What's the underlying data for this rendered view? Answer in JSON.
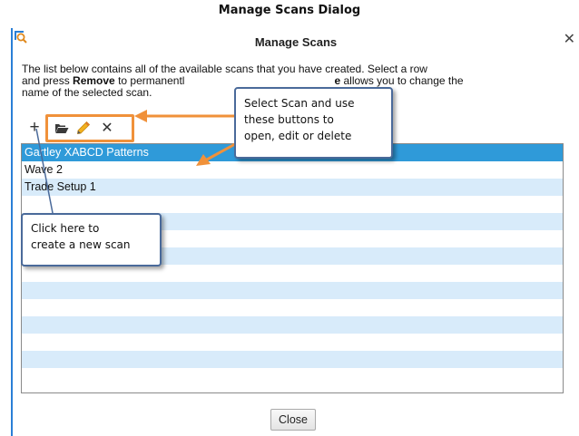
{
  "caption": "Manage Scans Dialog",
  "dialog": {
    "title": "Manage Scans",
    "app_icon": "scan-magnifier-icon",
    "close_glyph": "✕",
    "description": {
      "line1": "The list below contains all of the available scans that you have created.  Select a row",
      "line2_before": "and press ",
      "line2_bold": "Remove",
      "line2_mid": " to permanentl",
      "line2_bold2": "e",
      "line2_after": " allows you to change the",
      "line3": "name of the selected scan."
    },
    "toolbar": {
      "add_icon": "plus-icon",
      "add_glyph": "+",
      "open_icon": "folder-open-icon",
      "edit_icon": "pencil-icon",
      "delete_icon": "close-icon",
      "delete_glyph": "✕"
    },
    "scans": [
      {
        "name": "Gartley XABCD Patterns",
        "selected": true
      },
      {
        "name": "Wave 2",
        "selected": false
      },
      {
        "name": "Trade Setup 1",
        "selected": false
      },
      {
        "name": "",
        "selected": false
      },
      {
        "name": "",
        "selected": false
      },
      {
        "name": "",
        "selected": false
      },
      {
        "name": "",
        "selected": false
      },
      {
        "name": "",
        "selected": false
      },
      {
        "name": "",
        "selected": false
      },
      {
        "name": "",
        "selected": false
      },
      {
        "name": "",
        "selected": false
      },
      {
        "name": "",
        "selected": false
      },
      {
        "name": "",
        "selected": false
      },
      {
        "name": "",
        "selected": false
      }
    ],
    "close_button": "Close"
  },
  "callouts": {
    "edit": [
      "Select Scan and use",
      "these buttons to",
      "open, edit or delete"
    ],
    "add": [
      "Click here to",
      "create a new scan"
    ]
  },
  "colors": {
    "selected_row": "#2f9ad9",
    "alt_row": "#d8ebfa",
    "highlight_orange": "#f0913a",
    "callout_border": "#4a6a9a",
    "window_edge": "#2a7fd6"
  }
}
